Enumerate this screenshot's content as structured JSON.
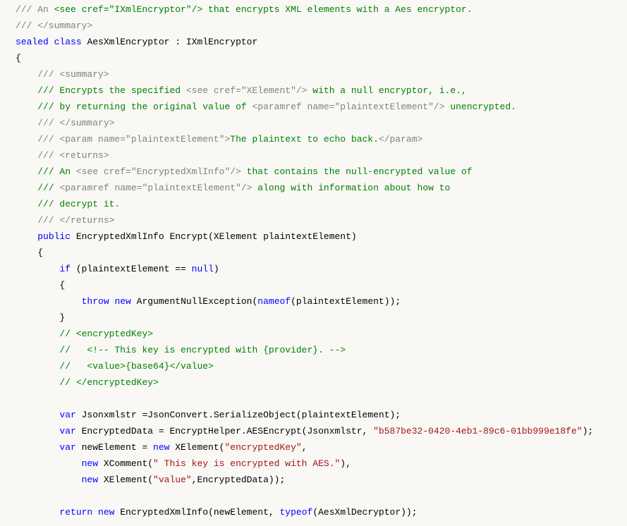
{
  "lines": [
    {
      "indent": 0,
      "segments": [
        {
          "t": "/// An ",
          "c": "comment-gray"
        },
        {
          "t": "<see cref=\"IXmlEncryptor\"/>",
          "c": "comment"
        },
        {
          "t": " that encrypts XML elements with a Aes encryptor.",
          "c": "comment"
        }
      ]
    },
    {
      "indent": 0,
      "segments": [
        {
          "t": "/// </summary>",
          "c": "comment-gray"
        }
      ]
    },
    {
      "indent": 0,
      "segments": [
        {
          "t": "sealed",
          "c": "keyword"
        },
        {
          "t": " ",
          "c": "type"
        },
        {
          "t": "class",
          "c": "keyword"
        },
        {
          "t": " AesXmlEncryptor : IXmlEncryptor",
          "c": "type"
        }
      ]
    },
    {
      "indent": 0,
      "segments": [
        {
          "t": "{",
          "c": "type"
        }
      ]
    },
    {
      "indent": 1,
      "segments": [
        {
          "t": "/// <summary>",
          "c": "comment-gray"
        }
      ]
    },
    {
      "indent": 1,
      "segments": [
        {
          "t": "/// Encrypts the specified ",
          "c": "comment"
        },
        {
          "t": "<see cref=\"XElement\"/>",
          "c": "comment-gray"
        },
        {
          "t": " with a null encryptor, i.e.,",
          "c": "comment"
        }
      ]
    },
    {
      "indent": 1,
      "segments": [
        {
          "t": "/// by returning the original value of ",
          "c": "comment"
        },
        {
          "t": "<paramref name=\"plaintextElement\"/>",
          "c": "comment-gray"
        },
        {
          "t": " unencrypted.",
          "c": "comment"
        }
      ]
    },
    {
      "indent": 1,
      "segments": [
        {
          "t": "/// </summary>",
          "c": "comment-gray"
        }
      ]
    },
    {
      "indent": 1,
      "segments": [
        {
          "t": "/// <param name=\"plaintextElement\">",
          "c": "comment-gray"
        },
        {
          "t": "The plaintext to echo back.",
          "c": "comment"
        },
        {
          "t": "</param>",
          "c": "comment-gray"
        }
      ]
    },
    {
      "indent": 1,
      "segments": [
        {
          "t": "/// <returns>",
          "c": "comment-gray"
        }
      ]
    },
    {
      "indent": 1,
      "segments": [
        {
          "t": "/// An ",
          "c": "comment"
        },
        {
          "t": "<see cref=\"EncryptedXmlInfo\"/>",
          "c": "comment-gray"
        },
        {
          "t": " that contains the null-encrypted value of",
          "c": "comment"
        }
      ]
    },
    {
      "indent": 1,
      "segments": [
        {
          "t": "/// ",
          "c": "comment"
        },
        {
          "t": "<paramref name=\"plaintextElement\"/>",
          "c": "comment-gray"
        },
        {
          "t": " along with information about how to",
          "c": "comment"
        }
      ]
    },
    {
      "indent": 1,
      "segments": [
        {
          "t": "/// decrypt it.",
          "c": "comment"
        }
      ]
    },
    {
      "indent": 1,
      "segments": [
        {
          "t": "/// </returns>",
          "c": "comment-gray"
        }
      ]
    },
    {
      "indent": 1,
      "segments": [
        {
          "t": "public",
          "c": "keyword"
        },
        {
          "t": " EncryptedXmlInfo Encrypt(XElement plaintextElement)",
          "c": "type"
        }
      ]
    },
    {
      "indent": 1,
      "segments": [
        {
          "t": "{",
          "c": "type"
        }
      ]
    },
    {
      "indent": 2,
      "segments": [
        {
          "t": "if",
          "c": "keyword"
        },
        {
          "t": " (plaintextElement == ",
          "c": "type"
        },
        {
          "t": "null",
          "c": "keyword"
        },
        {
          "t": ")",
          "c": "type"
        }
      ]
    },
    {
      "indent": 2,
      "segments": [
        {
          "t": "{",
          "c": "type"
        }
      ]
    },
    {
      "indent": 3,
      "segments": [
        {
          "t": "throw",
          "c": "keyword"
        },
        {
          "t": " ",
          "c": "type"
        },
        {
          "t": "new",
          "c": "keyword"
        },
        {
          "t": " ArgumentNullException(",
          "c": "type"
        },
        {
          "t": "nameof",
          "c": "keyword"
        },
        {
          "t": "(plaintextElement));",
          "c": "type"
        }
      ]
    },
    {
      "indent": 2,
      "segments": [
        {
          "t": "}",
          "c": "type"
        }
      ]
    },
    {
      "indent": 2,
      "segments": [
        {
          "t": "// <encryptedKey>",
          "c": "comment"
        }
      ]
    },
    {
      "indent": 2,
      "segments": [
        {
          "t": "//   <!-- This key is encrypted with {provider}. -->",
          "c": "comment"
        }
      ]
    },
    {
      "indent": 2,
      "segments": [
        {
          "t": "//   <value>{base64}</value>",
          "c": "comment"
        }
      ]
    },
    {
      "indent": 2,
      "segments": [
        {
          "t": "// </encryptedKey>",
          "c": "comment"
        }
      ]
    },
    {
      "indent": 0,
      "segments": []
    },
    {
      "indent": 2,
      "segments": [
        {
          "t": "var",
          "c": "keyword"
        },
        {
          "t": " Jsonxmlstr =JsonConvert.SerializeObject(plaintextElement);",
          "c": "type"
        }
      ]
    },
    {
      "indent": 2,
      "segments": [
        {
          "t": "var",
          "c": "keyword"
        },
        {
          "t": " EncryptedData = EncryptHelper.AESEncrypt(Jsonxmlstr, ",
          "c": "type"
        },
        {
          "t": "\"b587be32-0420-4eb1-89c6-01bb999e18fe\"",
          "c": "string"
        },
        {
          "t": ");",
          "c": "type"
        }
      ]
    },
    {
      "indent": 2,
      "segments": [
        {
          "t": "var",
          "c": "keyword"
        },
        {
          "t": " newElement = ",
          "c": "type"
        },
        {
          "t": "new",
          "c": "keyword"
        },
        {
          "t": " XElement(",
          "c": "type"
        },
        {
          "t": "\"encryptedKey\"",
          "c": "string"
        },
        {
          "t": ",",
          "c": "type"
        }
      ]
    },
    {
      "indent": 3,
      "segments": [
        {
          "t": "new",
          "c": "keyword"
        },
        {
          "t": " XComment(",
          "c": "type"
        },
        {
          "t": "\" This key is encrypted with AES.\"",
          "c": "string"
        },
        {
          "t": "),",
          "c": "type"
        }
      ]
    },
    {
      "indent": 3,
      "segments": [
        {
          "t": "new",
          "c": "keyword"
        },
        {
          "t": " XElement(",
          "c": "type"
        },
        {
          "t": "\"value\"",
          "c": "string"
        },
        {
          "t": ",EncryptedData));",
          "c": "type"
        }
      ]
    },
    {
      "indent": 0,
      "segments": []
    },
    {
      "indent": 2,
      "segments": [
        {
          "t": "return",
          "c": "keyword"
        },
        {
          "t": " ",
          "c": "type"
        },
        {
          "t": "new",
          "c": "keyword"
        },
        {
          "t": " EncryptedXmlInfo(newElement, ",
          "c": "type"
        },
        {
          "t": "typeof",
          "c": "keyword"
        },
        {
          "t": "(AesXmlDecryptor));",
          "c": "type"
        }
      ]
    }
  ],
  "indent_unit": "    "
}
